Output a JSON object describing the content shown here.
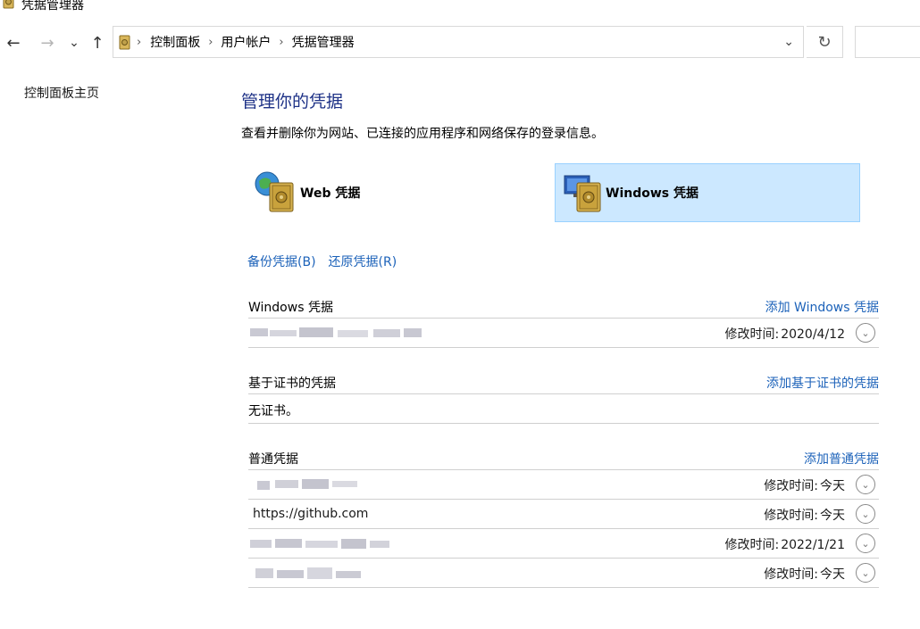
{
  "window": {
    "title": "凭据管理器"
  },
  "nav": {
    "back": "←",
    "forward": "→",
    "recent": "⌄",
    "up": "↑"
  },
  "address": {
    "crumbs": [
      "控制面板",
      "用户帐户",
      "凭据管理器"
    ],
    "separator": "›",
    "dropdown": "⌄",
    "refresh": "↻"
  },
  "leftnav": {
    "home": "控制面板主页"
  },
  "main": {
    "title": "管理你的凭据",
    "description": "查看并删除你为网站、已连接的应用程序和网络保存的登录信息。",
    "tiles": {
      "web": "Web 凭据",
      "windows": "Windows 凭据"
    },
    "links": {
      "backup": "备份凭据(B)",
      "restore": "还原凭据(R)"
    }
  },
  "sections": {
    "windows": {
      "title": "Windows 凭据",
      "add": "添加 Windows 凭据",
      "rows": [
        {
          "name": "",
          "meta_label": "修改时间:",
          "meta_value": "2020/4/12"
        }
      ]
    },
    "cert": {
      "title": "基于证书的凭据",
      "add": "添加基于证书的凭据",
      "empty": "无证书。"
    },
    "generic": {
      "title": "普通凭据",
      "add": "添加普通凭据",
      "rows": [
        {
          "name": "",
          "meta_label": "修改时间:",
          "meta_value": "今天"
        },
        {
          "name": "https://github.com",
          "meta_label": "修改时间:",
          "meta_value": "今天"
        },
        {
          "name": "",
          "meta_label": "修改时间:",
          "meta_value": "2022/1/21"
        },
        {
          "name": "",
          "meta_label": "修改时间:",
          "meta_value": "今天"
        }
      ]
    }
  },
  "colors": {
    "link": "#1c62b9",
    "title": "#1e3287",
    "selected_bg": "#cce8ff",
    "selected_border": "#99d1ff"
  },
  "icons": {
    "expand": "chevron-down-icon"
  }
}
